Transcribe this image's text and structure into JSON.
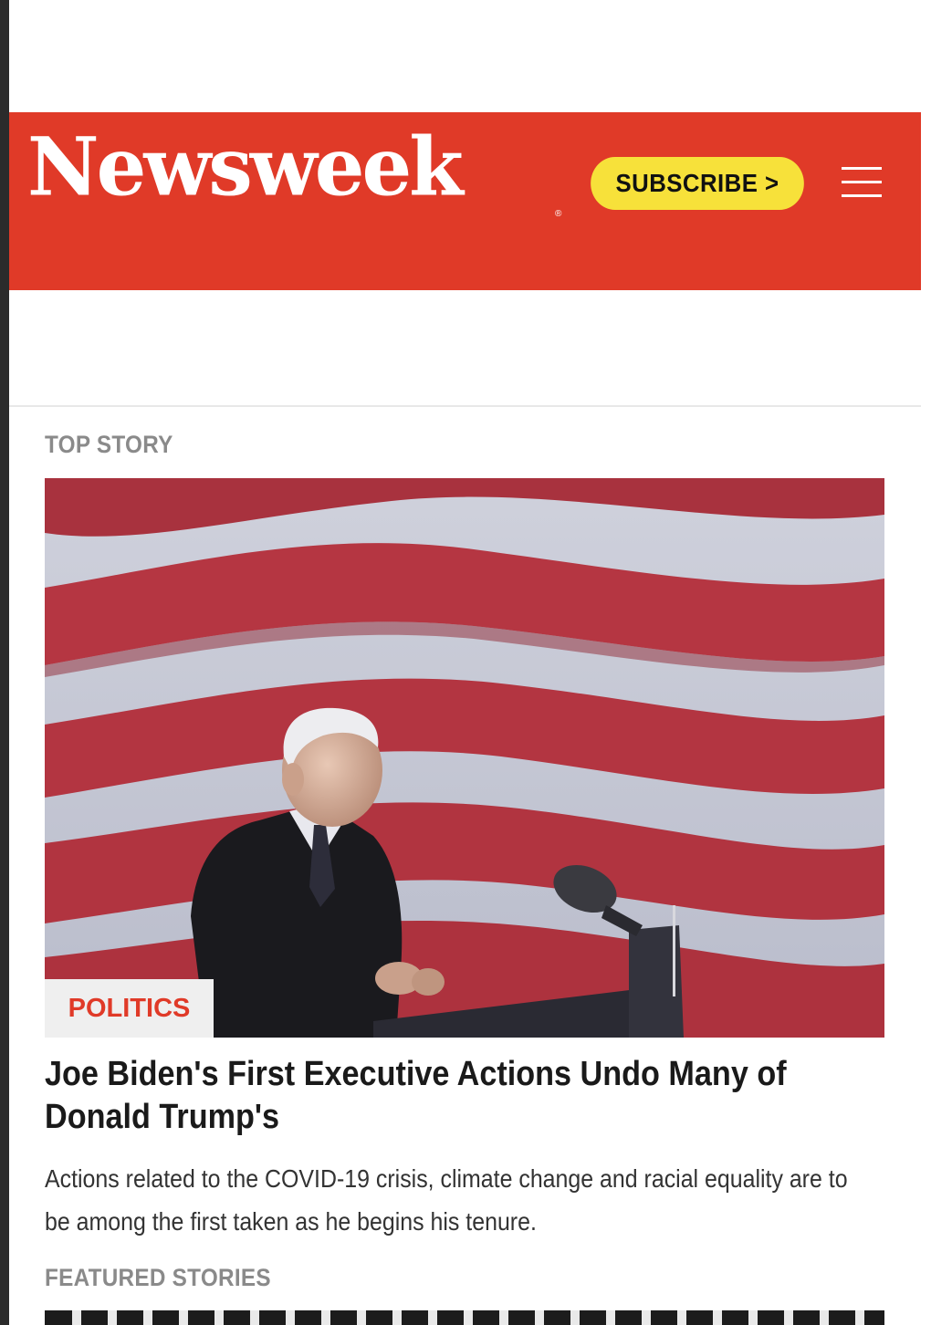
{
  "header": {
    "logo_text": "Newsweek",
    "logo_mark": "®",
    "subscribe_label": "SUBSCRIBE >",
    "menu_icon": "hamburger-menu-icon",
    "brand_color": "#e03a28",
    "subscribe_color": "#f7e13a"
  },
  "top_story": {
    "section_label": "TOP STORY",
    "category": "POLITICS",
    "headline": "Joe Biden's First Executive Actions Undo Many of Donald Trump's",
    "summary": "Actions related to the COVID-19 crisis, climate change and racial equality are to be among the first taken as he begins his tenure."
  },
  "featured": {
    "section_label": "FEATURED STORIES"
  }
}
